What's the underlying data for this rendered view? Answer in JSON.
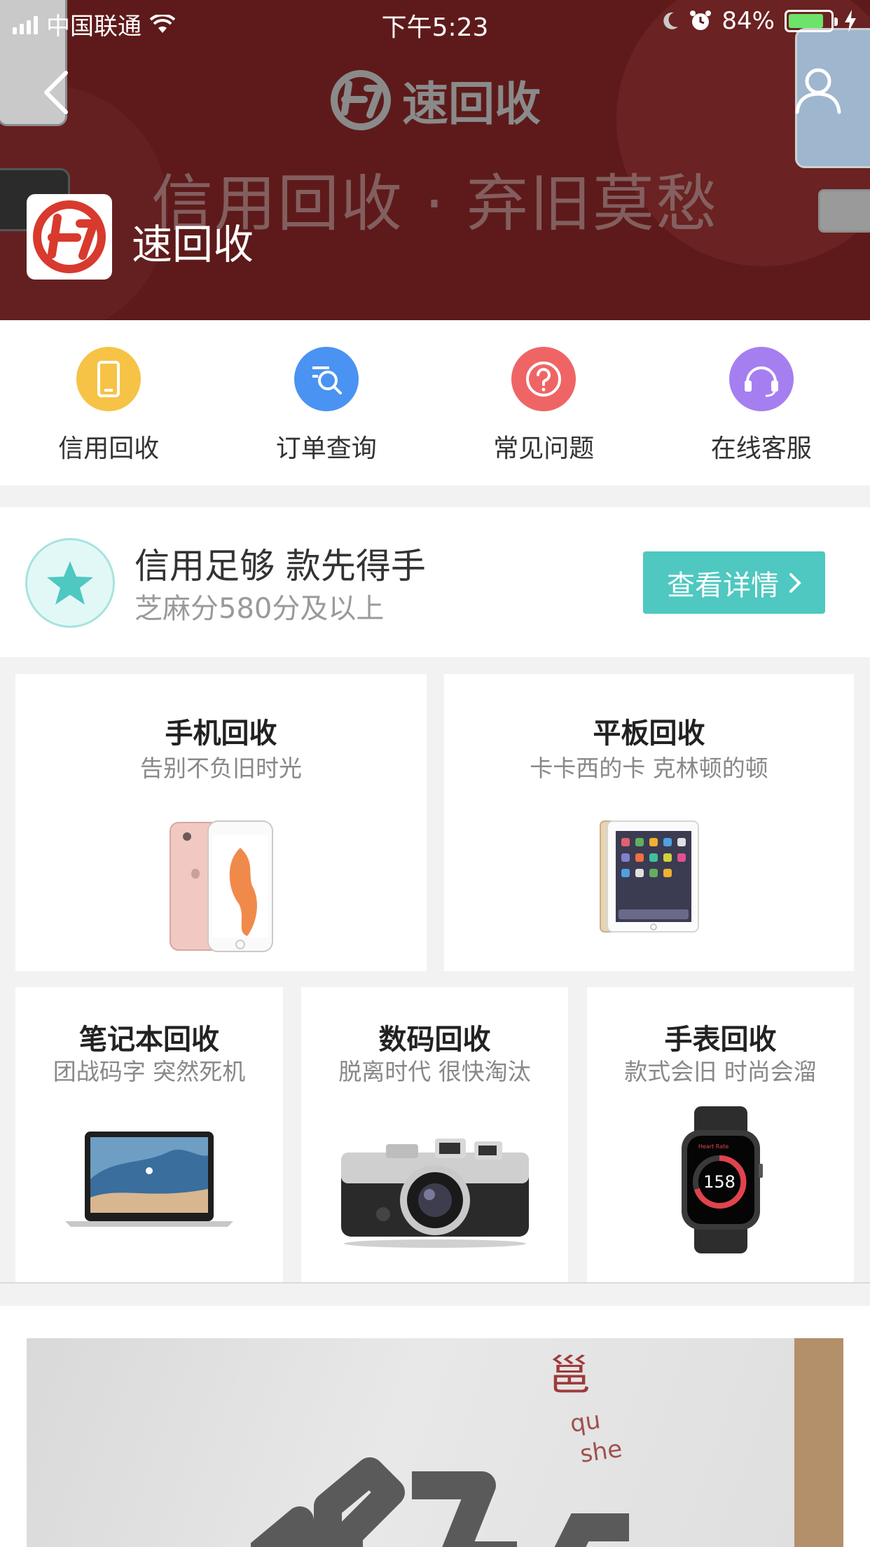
{
  "status_bar": {
    "carrier": "中国联通",
    "time": "下午5:23",
    "battery": "84%",
    "battery_level": 0.84
  },
  "header": {
    "brand": "速回收",
    "slogan": "信用回收 · 弃旧莫愁",
    "app_name": "速回收",
    "back_icon": "chevron-left-icon",
    "profile_icon": "user-icon",
    "background_color": "#5e1a1a"
  },
  "quick_nav": [
    {
      "label": "信用回收",
      "icon": "phone-icon",
      "color": "#f6c346"
    },
    {
      "label": "订单查询",
      "icon": "search-list-icon",
      "color": "#4a93f2"
    },
    {
      "label": "常见问题",
      "icon": "question-icon",
      "color": "#ef6565"
    },
    {
      "label": "在线客服",
      "icon": "headset-icon",
      "color": "#a57ff0"
    }
  ],
  "promo": {
    "title": "信用足够 款先得手",
    "subtitle": "芝麻分580分及以上",
    "button": "查看详情",
    "accent": "#4ec8c0"
  },
  "categories": [
    {
      "title": "手机回收",
      "subtitle": "告别不负旧时光"
    },
    {
      "title": "平板回收",
      "subtitle": "卡卡西的卡 克林顿的顿"
    },
    {
      "title": "笔记本回收",
      "subtitle": "团战码字 突然死机"
    },
    {
      "title": "数码回收",
      "subtitle": "脱离时代 很快淘汰"
    },
    {
      "title": "手表回收",
      "subtitle": "款式会旧 时尚会溜",
      "watch_value": "158"
    }
  ],
  "bottom_photo": {
    "stamp": "邕",
    "line1": "qu",
    "line2": "she"
  }
}
